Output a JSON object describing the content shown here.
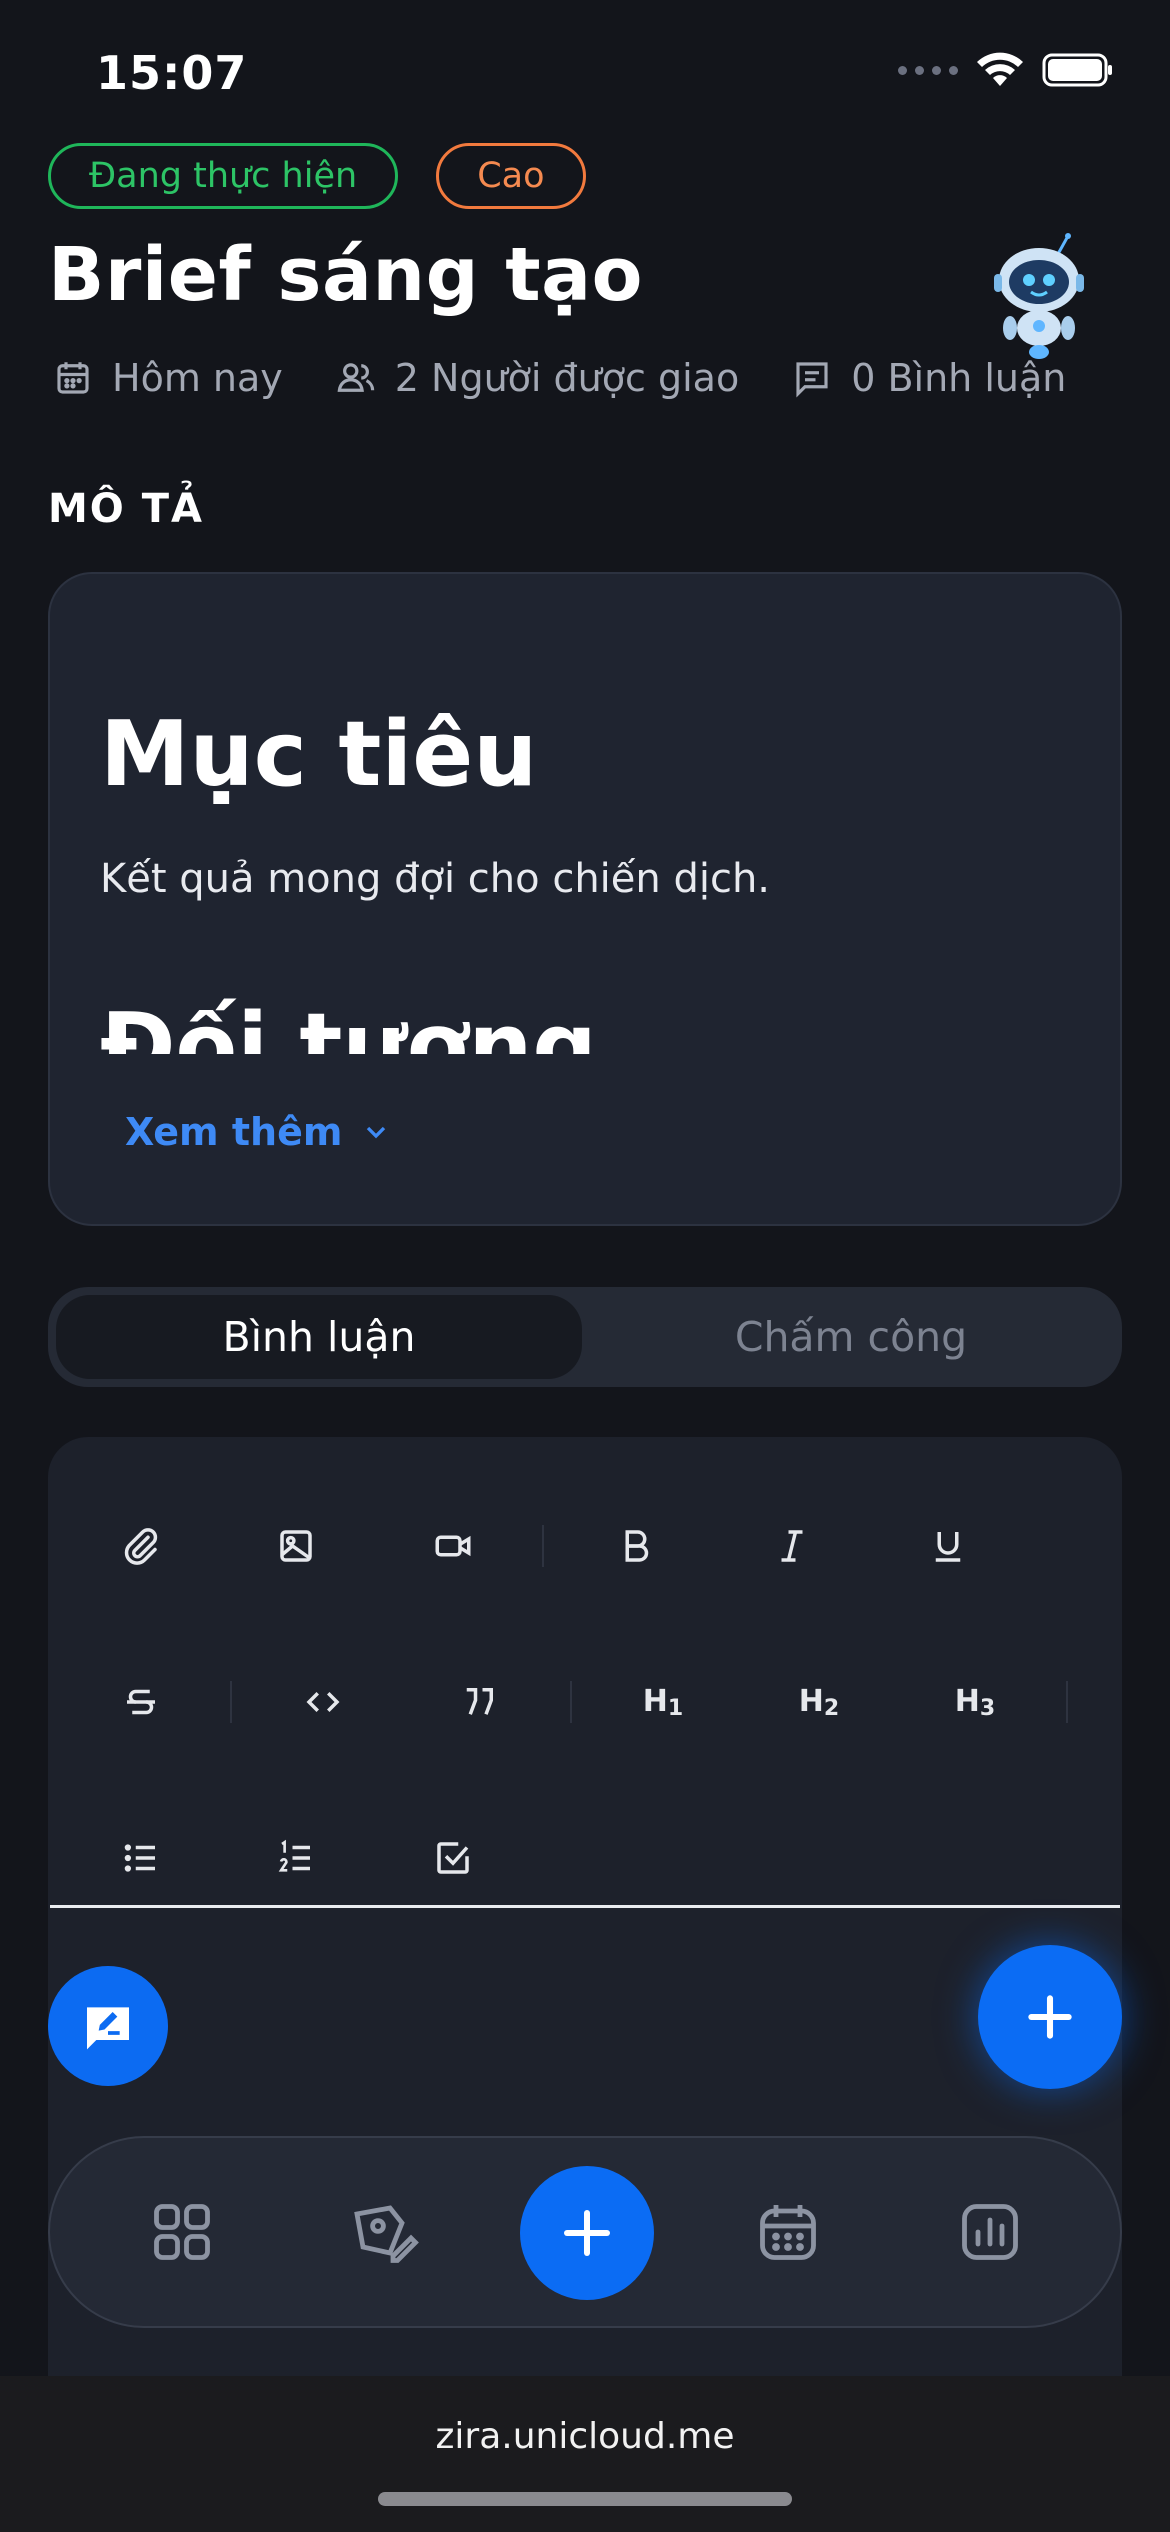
{
  "status_bar": {
    "time": "15:07"
  },
  "task": {
    "status_badge": "Đang thực hiện",
    "priority_badge": "Cao",
    "title": "Brief sáng tạo",
    "due": "Hôm nay",
    "assignees": "2 Người được giao",
    "comments": "0 Bình luận"
  },
  "description": {
    "section_label": "MÔ TẢ",
    "heading1": "Mục tiêu",
    "paragraph": "Kết quả mong đợi cho chiến dịch.",
    "heading2": "Đối tượng",
    "see_more": "Xem thêm"
  },
  "tabs": [
    {
      "label": "Bình luận",
      "active": true
    },
    {
      "label": "Chấm công",
      "active": false
    }
  ],
  "toolbar": {
    "icons": [
      "paperclip-icon",
      "image-icon",
      "video-icon",
      "bold-icon",
      "italic-icon",
      "underline-icon",
      "strikethrough-icon",
      "code-icon",
      "quote-icon",
      "heading1-icon",
      "heading2-icon",
      "heading3-icon",
      "bullet-list-icon",
      "numbered-list-icon",
      "checklist-icon"
    ],
    "h1": "H",
    "h1_sub": "1",
    "h2": "H",
    "h2_sub": "2",
    "h3": "H",
    "h3_sub": "3"
  },
  "bottom_nav": {
    "icons": [
      "grid-icon",
      "edit-tag-icon",
      "plus-icon",
      "calendar-icon",
      "chart-icon"
    ]
  },
  "browser": {
    "url": "zira.unicloud.me"
  },
  "colors": {
    "background": "#13151b",
    "card": "#1f2430",
    "accent": "#0b6cf4",
    "status_green": "#2dc466",
    "priority_orange": "#f58a50",
    "link_blue": "#3e8af5"
  }
}
